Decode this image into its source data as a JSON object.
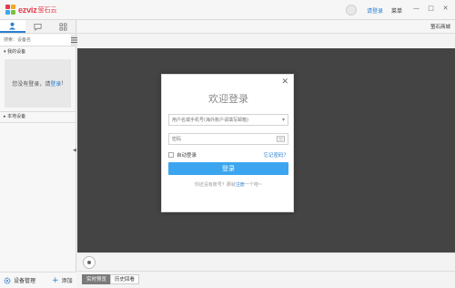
{
  "app": {
    "logo_text": "ezviz",
    "logo_cn": "萤石云",
    "header_login": "请登录",
    "header_menu": "菜单",
    "win_min": "—",
    "win_max": "□",
    "win_close": "✕"
  },
  "sidebar": {
    "search_placeholder": "搜索：设备名",
    "my_devices": "我的设备",
    "empty_text": "您没有登录，请",
    "empty_link": "登录",
    "empty_suffix": "!",
    "local_devices": "本地设备",
    "collapse": "◀",
    "footer_manage": "设备管理",
    "footer_add": "添加"
  },
  "toolbar": {
    "store": "萤石商城"
  },
  "player": {
    "tabs": [
      "实时预览",
      "历史回看"
    ]
  },
  "dialog": {
    "title": "欢迎登录",
    "close": "✕",
    "account_placeholder": "用户名或手机号(海外账户请填写邮箱)",
    "password_placeholder": "密码",
    "auto_login": "自动登录",
    "forgot": "忘记密码？",
    "login_button": "登录",
    "register_prefix": "你还没有账号？那就",
    "register_link": "注册",
    "register_suffix": "一个吧~"
  },
  "colors": {
    "accent": "#3ba6ef",
    "link": "#2a7ed2",
    "brand": "#e6394a",
    "video_bg": "#444444"
  }
}
